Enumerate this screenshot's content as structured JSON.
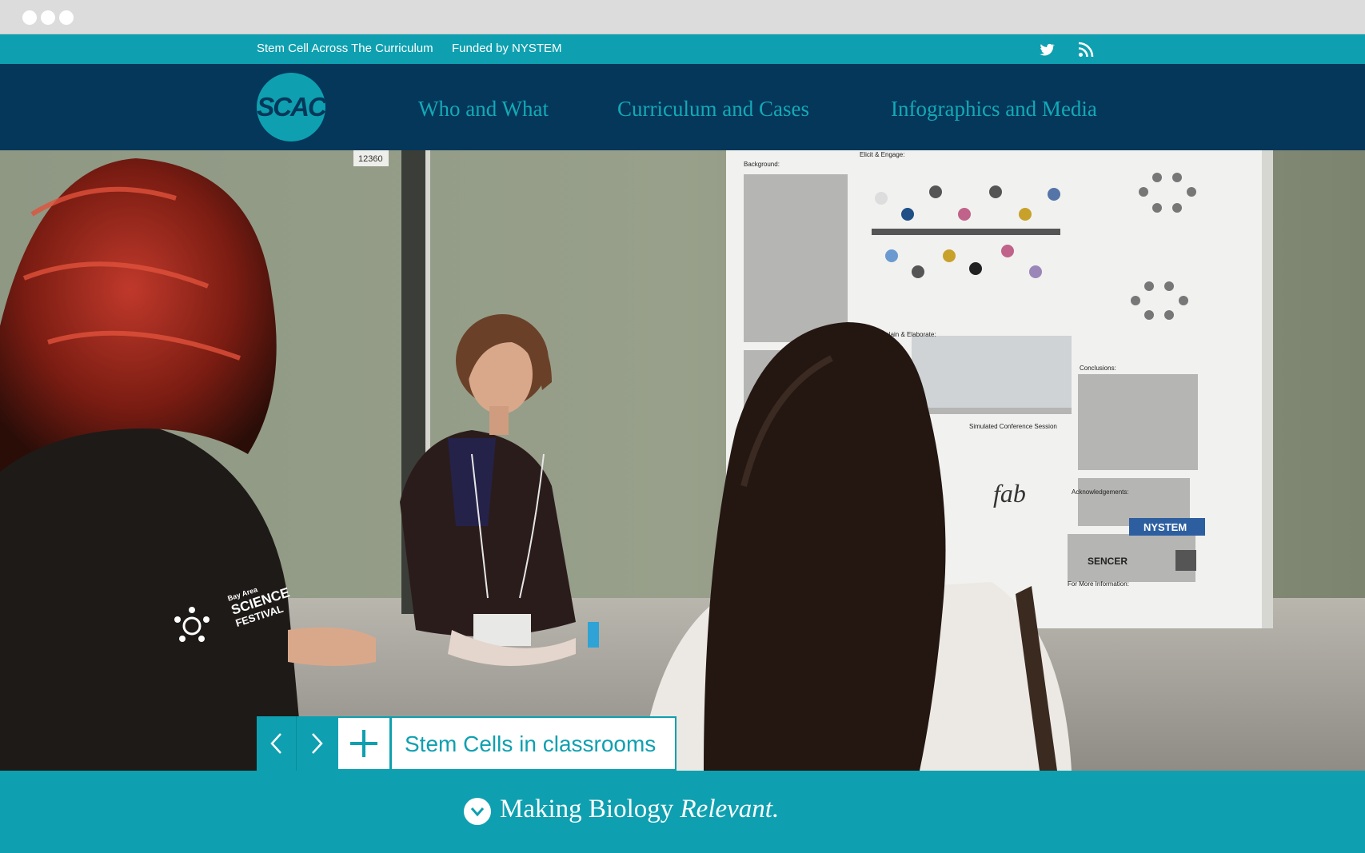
{
  "topbar": {
    "site_title": "Stem Cell Across The Curriculum",
    "funded_by": "Funded by NYSTEM",
    "icons": [
      "twitter-icon",
      "rss-icon"
    ]
  },
  "nav": {
    "logo_text": "SCAC",
    "items": [
      {
        "label": "Who and What"
      },
      {
        "label": "Curriculum and Cases"
      },
      {
        "label": "Infographics and Media"
      }
    ]
  },
  "hero": {
    "photo": "Students discussing a scientific poster at a conference session",
    "poster": {
      "headings": [
        "Background:",
        "Elicit & Engage:",
        "Explain & Elaborate:",
        "Conclusions:",
        "Acknowledgements:",
        "For More Information:",
        "Simulated Conference Session"
      ],
      "logos": [
        "fab",
        "SENCER",
        "NYSTEM"
      ],
      "tag_number": "12360"
    },
    "shirt_text": [
      "Bay Area",
      "SCIENCE",
      "FESTIVAL"
    ]
  },
  "slider": {
    "prev_icon": "chevron-left-icon",
    "next_icon": "chevron-right-icon",
    "expand_icon": "plus-icon",
    "caption": "Stem Cells in classrooms"
  },
  "tagline": {
    "icon": "chevron-down-circle-icon",
    "text": "Making Biology ",
    "emphasis": "Relevant."
  },
  "colors": {
    "teal": "#0ea0b0",
    "navy": "#04375a",
    "nav_text": "#13a9b7",
    "chrome": "#dcdcdc"
  }
}
